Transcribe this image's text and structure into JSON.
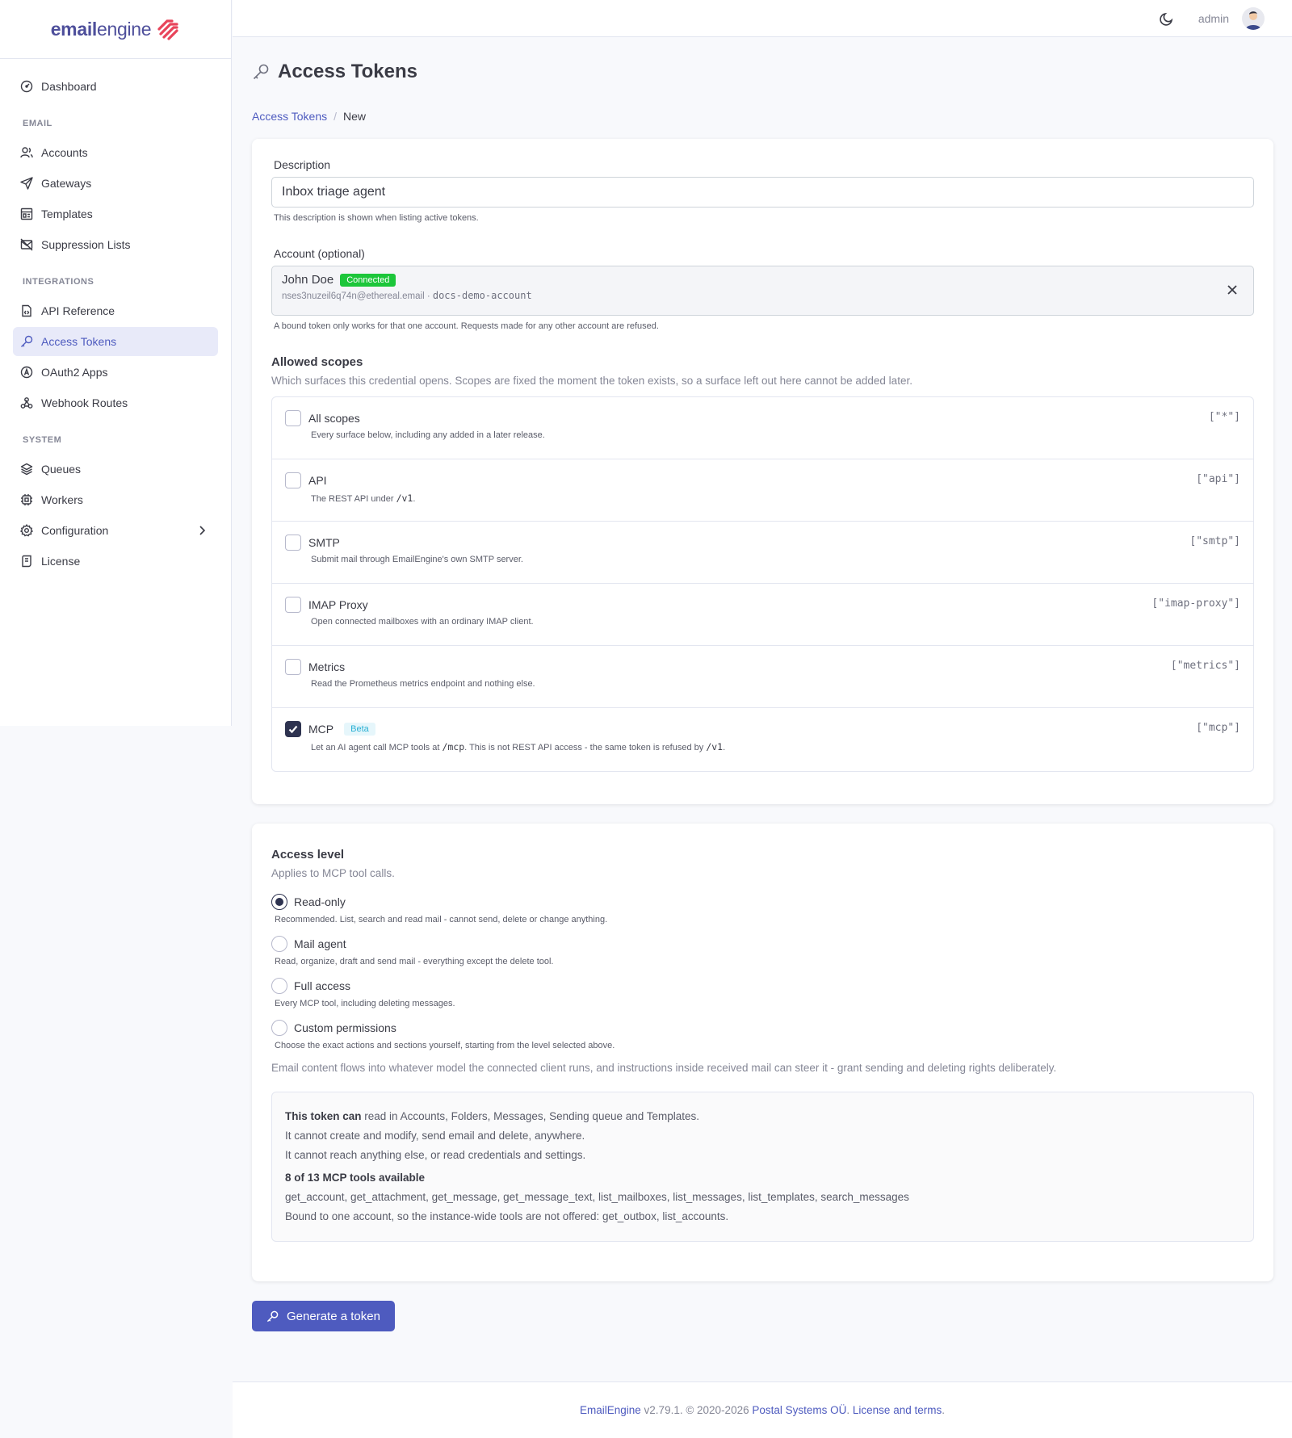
{
  "brand": {
    "name_bold": "email",
    "name_rest": "engine"
  },
  "sidebar": {
    "dashboard": "Dashboard",
    "email_heading": "EMAIL",
    "email_items": [
      "Accounts",
      "Gateways",
      "Templates",
      "Suppression Lists"
    ],
    "integrations_heading": "INTEGRATIONS",
    "integrations_items": [
      "API Reference",
      "Access Tokens",
      "OAuth2 Apps",
      "Webhook Routes"
    ],
    "system_heading": "SYSTEM",
    "system_items": [
      "Queues",
      "Workers",
      "Configuration",
      "License"
    ]
  },
  "topbar": {
    "username": "admin"
  },
  "page": {
    "title": "Access Tokens"
  },
  "breadcrumb": {
    "parent": "Access Tokens",
    "separator": "/",
    "current": "New"
  },
  "form": {
    "description": {
      "label": "Description",
      "value": "Inbox triage agent",
      "help": "This description is shown when listing active tokens."
    },
    "account": {
      "label": "Account (optional)",
      "name": "John Doe",
      "status": "Connected",
      "email": "nses3nuzeil6q74n@ethereal.email · ",
      "account_id": "docs-demo-account",
      "help": "A bound token only works for that one account. Requests made for any other account are refused."
    },
    "scopes": {
      "heading": "Allowed scopes",
      "subtitle": "Which surfaces this credential opens. Scopes are fixed the moment the token exists, so a surface left out here cannot be added later.",
      "items": [
        {
          "name": "All scopes",
          "code": "[\"*\"]",
          "checked": false,
          "desc": "Every surface below, including any added in a later release."
        },
        {
          "name": "API",
          "code": "[\"api\"]",
          "checked": false,
          "desc_pre": "The REST API under ",
          "desc_code": "/v1",
          "desc_post": "."
        },
        {
          "name": "SMTP",
          "code": "[\"smtp\"]",
          "checked": false,
          "desc": "Submit mail through EmailEngine's own SMTP server."
        },
        {
          "name": "IMAP Proxy",
          "code": "[\"imap-proxy\"]",
          "checked": false,
          "desc": "Open connected mailboxes with an ordinary IMAP client."
        },
        {
          "name": "Metrics",
          "code": "[\"metrics\"]",
          "checked": false,
          "desc": "Read the Prometheus metrics endpoint and nothing else."
        },
        {
          "name": "MCP",
          "badge": "Beta",
          "code": "[\"mcp\"]",
          "checked": true,
          "desc_pre": "Let an AI agent call MCP tools at ",
          "desc_code": "/mcp",
          "desc_mid": ". This is not REST API access - the same token is refused by ",
          "desc_code2": "/v1",
          "desc_post": "."
        }
      ]
    },
    "access_level": {
      "heading": "Access level",
      "subtitle": "Applies to MCP tool calls.",
      "options": [
        {
          "label": "Read-only",
          "desc": "Recommended. List, search and read mail - cannot send, delete or change anything.",
          "selected": true
        },
        {
          "label": "Mail agent",
          "desc": "Read, organize, draft and send mail - everything except the delete tool.",
          "selected": false
        },
        {
          "label": "Full access",
          "desc": "Every MCP tool, including deleting messages.",
          "selected": false
        },
        {
          "label": "Custom permissions",
          "desc": "Choose the exact actions and sections yourself, starting from the level selected above.",
          "selected": false
        }
      ],
      "warning": "Email content flows into whatever model the connected client runs, and instructions inside received mail can steer it - grant sending and deleting rights deliberately."
    },
    "summary": {
      "can_bold": "This token can",
      "can_rest": " read in Accounts, Folders, Messages, Sending queue and Templates.",
      "cannot_1": "It cannot create and modify, send email and delete, anywhere.",
      "cannot_2": "It cannot reach anything else, or read credentials and settings.",
      "tools_heading": "8 of 13 MCP tools available",
      "tools_list": "get_account, get_attachment, get_message, get_message_text, list_mailboxes, list_messages, list_templates, search_messages",
      "bound_note": "Bound to one account, so the instance-wide tools are not offered: get_outbox, list_accounts."
    },
    "submit_label": "Generate a token"
  },
  "footer": {
    "product": "EmailEngine",
    "version": " v2.79.1. © 2020-2026 ",
    "company": "Postal Systems OÜ",
    "dot": ".",
    "license": "License and terms",
    "end": "."
  },
  "colors": {
    "accent": "#4e5bbf",
    "connected": "#1cc63a",
    "beta_text": "#2bb0d4",
    "active_nav_bg": "#e8eaf9"
  }
}
